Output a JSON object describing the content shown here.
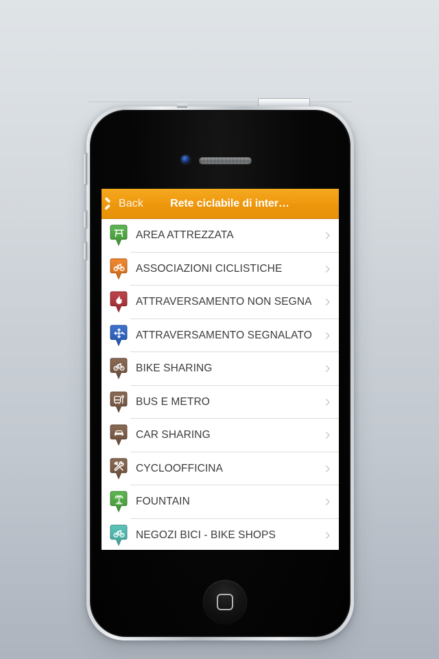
{
  "device": {
    "name": "smartphone-mockup",
    "home_button": "home-button",
    "camera": "front-camera",
    "earpiece": "earpiece-speaker",
    "buttons": [
      "mute-switch",
      "volume-up",
      "volume-down",
      "power-button"
    ]
  },
  "screen": {
    "nav": {
      "back_label": "Back",
      "title": "Rete ciclabile di inter…",
      "background_color": "#ef9a10",
      "title_color": "#ffffff"
    },
    "list": {
      "rows": [
        {
          "label": "AREA ATTREZZATA",
          "icon": "picnic-table-pin-icon",
          "color": "#4caf3f"
        },
        {
          "label": "ASSOCIAZIONI CICLISTICHE",
          "icon": "bicycle-pin-icon",
          "color": "#f07d1a"
        },
        {
          "label": "ATTRAVERSAMENTO NON SEGNA",
          "icon": "flame-pin-icon",
          "color": "#b53137"
        },
        {
          "label": "ATTRAVERSAMENTO SEGNALATO",
          "icon": "crossing-arrows-pin-icon",
          "color": "#2a63c9"
        },
        {
          "label": "BIKE SHARING",
          "icon": "bicycle-pin-icon",
          "color": "#7d5b43"
        },
        {
          "label": "BUS E METRO",
          "icon": "bus-pin-icon",
          "color": "#7d5b43"
        },
        {
          "label": "CAR SHARING",
          "icon": "car-pin-icon",
          "color": "#7d5b43"
        },
        {
          "label": "CYCLOOFFICINA",
          "icon": "tools-pin-icon",
          "color": "#7d5b43"
        },
        {
          "label": "FOUNTAIN",
          "icon": "fountain-pin-icon",
          "color": "#4caf3f"
        },
        {
          "label": "NEGOZI BICI - BIKE SHOPS",
          "icon": "bicycle-pin-icon",
          "color": "#4bbfb4"
        }
      ],
      "chevron_icon": "chevron-right-icon",
      "text_color": "#3b3b3b"
    }
  }
}
